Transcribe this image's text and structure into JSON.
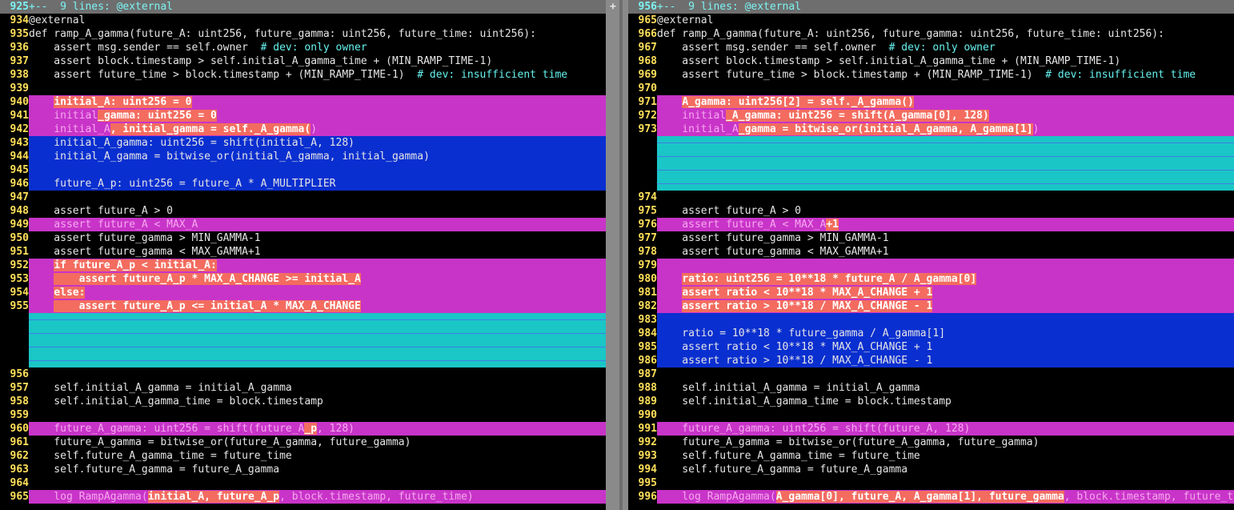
{
  "fold_marker": "+--  9 lines: @external",
  "divider_plus": "+",
  "left": {
    "fold_num": "925",
    "lines": [
      {
        "n": "934",
        "t": "plain",
        "s": [
          {
            "x": "@external"
          }
        ]
      },
      {
        "n": "935",
        "t": "plain",
        "s": [
          {
            "x": "def ramp_A_gamma(future_A: uint256, future_gamma: uint256, future_time: uint256):"
          }
        ]
      },
      {
        "n": "936",
        "t": "plain",
        "s": [
          {
            "x": "    assert msg.sender == self.owner  "
          },
          {
            "x": "# dev: only owner",
            "c": "cmt"
          }
        ]
      },
      {
        "n": "937",
        "t": "plain",
        "s": [
          {
            "x": "    assert block.timestamp > self.initial_A_gamma_time + (MIN_RAMP_TIME-1)"
          }
        ]
      },
      {
        "n": "938",
        "t": "plain",
        "s": [
          {
            "x": "    assert future_time > block.timestamp + (MIN_RAMP_TIME-1)  "
          },
          {
            "x": "# dev: insufficient time",
            "c": "cmt"
          }
        ]
      },
      {
        "n": "939",
        "t": "plain",
        "s": [
          {
            "x": ""
          }
        ]
      },
      {
        "n": "940",
        "t": "chg",
        "s": [
          {
            "x": "    "
          },
          {
            "x": "initial_A: uint256 = 0",
            "c": "hl"
          }
        ]
      },
      {
        "n": "941",
        "t": "chg",
        "s": [
          {
            "x": "    initial",
            "c": "dimtxt"
          },
          {
            "x": "_gamma: uint256 = 0",
            "c": "hl"
          }
        ]
      },
      {
        "n": "942",
        "t": "chg",
        "s": [
          {
            "x": "    initial_A",
            "c": "dimtxt"
          },
          {
            "x": ", initial_gamma = self._A_gamma(",
            "c": "hl"
          },
          {
            "x": ")",
            "c": "dimtxt"
          }
        ]
      },
      {
        "n": "943",
        "t": "add",
        "s": [
          {
            "x": "    initial_A_gamma: uint256 = shift(initial_A, 128)"
          }
        ]
      },
      {
        "n": "944",
        "t": "add",
        "s": [
          {
            "x": "    initial_A_gamma = bitwise_or(initial_A_gamma, initial_gamma)"
          }
        ]
      },
      {
        "n": "945",
        "t": "add",
        "s": [
          {
            "x": ""
          }
        ]
      },
      {
        "n": "946",
        "t": "add",
        "s": [
          {
            "x": "    future_A_p: uint256 = future_A * A_MULTIPLIER"
          }
        ]
      },
      {
        "n": "947",
        "t": "plain",
        "s": [
          {
            "x": ""
          }
        ]
      },
      {
        "n": "948",
        "t": "plain",
        "s": [
          {
            "x": "    assert future_A > 0"
          }
        ]
      },
      {
        "n": "949",
        "t": "chg",
        "s": [
          {
            "x": "    assert future_A < MAX_A",
            "c": "dimtxt"
          }
        ]
      },
      {
        "n": "950",
        "t": "plain",
        "s": [
          {
            "x": "    assert future_gamma > MIN_GAMMA-1"
          }
        ]
      },
      {
        "n": "951",
        "t": "plain",
        "s": [
          {
            "x": "    assert future_gamma < MAX_GAMMA+1"
          }
        ]
      },
      {
        "n": "952",
        "t": "chg",
        "s": [
          {
            "x": "    "
          },
          {
            "x": "if future_A_p < initial_A:",
            "c": "hl"
          }
        ]
      },
      {
        "n": "953",
        "t": "chg",
        "s": [
          {
            "x": "    "
          },
          {
            "x": "    assert future_A_p * MAX_A_CHANGE >= initial_A",
            "c": "hl"
          }
        ]
      },
      {
        "n": "954",
        "t": "chg",
        "s": [
          {
            "x": "    "
          },
          {
            "x": "else:",
            "c": "hl"
          }
        ]
      },
      {
        "n": "955",
        "t": "chg",
        "s": [
          {
            "x": "    "
          },
          {
            "x": "    assert future_A_p <= initial_A * MAX_A_CHANGE",
            "c": "hl"
          }
        ]
      },
      {
        "n": "",
        "t": "fill",
        "s": [
          {
            "x": ""
          }
        ]
      },
      {
        "n": "",
        "t": "fill",
        "s": [
          {
            "x": ""
          }
        ]
      },
      {
        "n": "",
        "t": "fill",
        "s": [
          {
            "x": ""
          }
        ]
      },
      {
        "n": "",
        "t": "fill",
        "s": [
          {
            "x": ""
          }
        ]
      },
      {
        "n": "956",
        "t": "plain",
        "s": [
          {
            "x": ""
          }
        ]
      },
      {
        "n": "957",
        "t": "plain",
        "s": [
          {
            "x": "    self.initial_A_gamma = initial_A_gamma"
          }
        ]
      },
      {
        "n": "958",
        "t": "plain",
        "s": [
          {
            "x": "    self.initial_A_gamma_time = block.timestamp"
          }
        ]
      },
      {
        "n": "959",
        "t": "plain",
        "s": [
          {
            "x": ""
          }
        ]
      },
      {
        "n": "960",
        "t": "chg",
        "s": [
          {
            "x": "    future_A_gamma: uint256 = shift(future_A",
            "c": "dimtxt"
          },
          {
            "x": "_p",
            "c": "hl"
          },
          {
            "x": ", 128)",
            "c": "dimtxt"
          }
        ]
      },
      {
        "n": "961",
        "t": "plain",
        "s": [
          {
            "x": "    future_A_gamma = bitwise_or(future_A_gamma, future_gamma)"
          }
        ]
      },
      {
        "n": "962",
        "t": "plain",
        "s": [
          {
            "x": "    self.future_A_gamma_time = future_time"
          }
        ]
      },
      {
        "n": "963",
        "t": "plain",
        "s": [
          {
            "x": "    self.future_A_gamma = future_A_gamma"
          }
        ]
      },
      {
        "n": "964",
        "t": "plain",
        "s": [
          {
            "x": ""
          }
        ]
      },
      {
        "n": "965",
        "t": "chg",
        "s": [
          {
            "x": "    log RampAgamma(",
            "c": "dimtxt"
          },
          {
            "x": "initial_A, future_A_p",
            "c": "hl"
          },
          {
            "x": ", block.timestamp, future_time)",
            "c": "dimtxt"
          }
        ]
      }
    ]
  },
  "right": {
    "fold_num": "956",
    "lines": [
      {
        "n": "965",
        "t": "plain",
        "s": [
          {
            "x": "@external"
          }
        ]
      },
      {
        "n": "966",
        "t": "plain",
        "s": [
          {
            "x": "def ramp_A_gamma(future_A: uint256, future_gamma: uint256, future_time: uint256):"
          }
        ]
      },
      {
        "n": "967",
        "t": "plain",
        "s": [
          {
            "x": "    assert msg.sender == self.owner  "
          },
          {
            "x": "# dev: only owner",
            "c": "cmt"
          }
        ]
      },
      {
        "n": "968",
        "t": "plain",
        "s": [
          {
            "x": "    assert block.timestamp > self.initial_A_gamma_time + (MIN_RAMP_TIME-1)"
          }
        ]
      },
      {
        "n": "969",
        "t": "plain",
        "s": [
          {
            "x": "    assert future_time > block.timestamp + (MIN_RAMP_TIME-1)  "
          },
          {
            "x": "# dev: insufficient time",
            "c": "cmt"
          }
        ]
      },
      {
        "n": "970",
        "t": "plain",
        "s": [
          {
            "x": ""
          }
        ]
      },
      {
        "n": "971",
        "t": "chg",
        "s": [
          {
            "x": "    "
          },
          {
            "x": "A_gamma: uint256[2] = self._A_gamma()",
            "c": "hl"
          }
        ]
      },
      {
        "n": "972",
        "t": "chg",
        "s": [
          {
            "x": "    initial",
            "c": "dimtxt"
          },
          {
            "x": "_A_gamma: uint256 = shift(A_gamma[0], 128)",
            "c": "hl"
          }
        ]
      },
      {
        "n": "973",
        "t": "chg",
        "s": [
          {
            "x": "    initial_A",
            "c": "dimtxt"
          },
          {
            "x": "_gamma = bitwise_or(initial_A_gamma, A_gamma[1]",
            "c": "hl"
          },
          {
            "x": ")",
            "c": "dimtxt"
          }
        ]
      },
      {
        "n": "",
        "t": "fill",
        "s": [
          {
            "x": ""
          }
        ]
      },
      {
        "n": "",
        "t": "fill",
        "s": [
          {
            "x": ""
          }
        ]
      },
      {
        "n": "",
        "t": "fill",
        "s": [
          {
            "x": ""
          }
        ]
      },
      {
        "n": "",
        "t": "fill",
        "s": [
          {
            "x": ""
          }
        ]
      },
      {
        "n": "974",
        "t": "plain",
        "s": [
          {
            "x": ""
          }
        ]
      },
      {
        "n": "975",
        "t": "plain",
        "s": [
          {
            "x": "    assert future_A > 0"
          }
        ]
      },
      {
        "n": "976",
        "t": "chg",
        "s": [
          {
            "x": "    assert future_A < MAX_A",
            "c": "dimtxt"
          },
          {
            "x": "+1",
            "c": "hl"
          }
        ]
      },
      {
        "n": "977",
        "t": "plain",
        "s": [
          {
            "x": "    assert future_gamma > MIN_GAMMA-1"
          }
        ]
      },
      {
        "n": "978",
        "t": "plain",
        "s": [
          {
            "x": "    assert future_gamma < MAX_GAMMA+1"
          }
        ]
      },
      {
        "n": "979",
        "t": "chg",
        "s": [
          {
            "x": ""
          }
        ]
      },
      {
        "n": "980",
        "t": "chg",
        "s": [
          {
            "x": "    "
          },
          {
            "x": "ratio: uint256 = 10**18 * future_A / A_gamma[0]",
            "c": "hl"
          }
        ]
      },
      {
        "n": "981",
        "t": "chg",
        "s": [
          {
            "x": "    "
          },
          {
            "x": "assert ratio < 10**18 * MAX_A_CHANGE + 1",
            "c": "hl"
          }
        ]
      },
      {
        "n": "982",
        "t": "chg",
        "s": [
          {
            "x": "    "
          },
          {
            "x": "assert ratio > 10**18 / MAX_A_CHANGE - 1",
            "c": "hl"
          }
        ]
      },
      {
        "n": "983",
        "t": "add",
        "s": [
          {
            "x": ""
          }
        ]
      },
      {
        "n": "984",
        "t": "add",
        "s": [
          {
            "x": "    ratio = 10**18 * future_gamma / A_gamma[1]"
          }
        ]
      },
      {
        "n": "985",
        "t": "add",
        "s": [
          {
            "x": "    assert ratio < 10**18 * MAX_A_CHANGE + 1"
          }
        ]
      },
      {
        "n": "986",
        "t": "add",
        "s": [
          {
            "x": "    assert ratio > 10**18 / MAX_A_CHANGE - 1"
          }
        ]
      },
      {
        "n": "987",
        "t": "plain",
        "s": [
          {
            "x": ""
          }
        ]
      },
      {
        "n": "988",
        "t": "plain",
        "s": [
          {
            "x": "    self.initial_A_gamma = initial_A_gamma"
          }
        ]
      },
      {
        "n": "989",
        "t": "plain",
        "s": [
          {
            "x": "    self.initial_A_gamma_time = block.timestamp"
          }
        ]
      },
      {
        "n": "990",
        "t": "plain",
        "s": [
          {
            "x": ""
          }
        ]
      },
      {
        "n": "991",
        "t": "chg",
        "s": [
          {
            "x": "    future_A_gamma: uint256 = shift(future_A, 128)",
            "c": "dimtxt"
          }
        ]
      },
      {
        "n": "992",
        "t": "plain",
        "s": [
          {
            "x": "    future_A_gamma = bitwise_or(future_A_gamma, future_gamma)"
          }
        ]
      },
      {
        "n": "993",
        "t": "plain",
        "s": [
          {
            "x": "    self.future_A_gamma_time = future_time"
          }
        ]
      },
      {
        "n": "994",
        "t": "plain",
        "s": [
          {
            "x": "    self.future_A_gamma = future_A_gamma"
          }
        ]
      },
      {
        "n": "995",
        "t": "plain",
        "s": [
          {
            "x": ""
          }
        ]
      },
      {
        "n": "996",
        "t": "chg",
        "s": [
          {
            "x": "    log RampAgamma(",
            "c": "dimtxt"
          },
          {
            "x": "A_gamma[0], future_A, A_gamma[1], future_gamma",
            "c": "hl"
          },
          {
            "x": ", block.timestamp, future_time)",
            "c": "dimtxt"
          }
        ]
      }
    ]
  },
  "colors": {
    "changed_line": "#c834c8",
    "added_line": "#0a2fd0",
    "filler_line": "#1ac6c6",
    "changed_text": "#f36c5f",
    "line_number": "#ffe05a",
    "comment": "#66f2ee",
    "fold_bar": "#6e6e6e"
  }
}
